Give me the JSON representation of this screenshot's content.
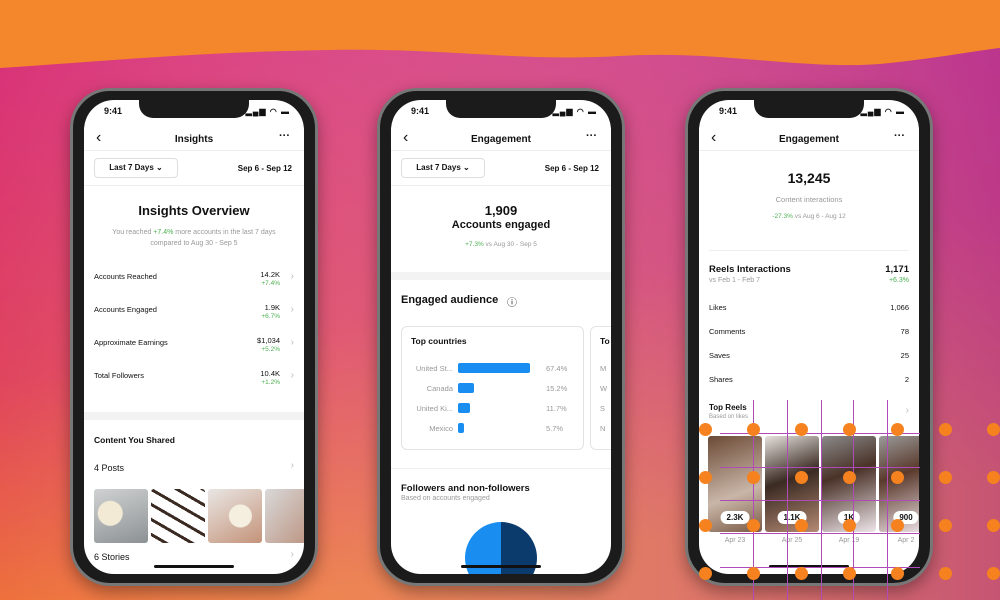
{
  "colors": {
    "accent_blue": "#1a8ef0",
    "pie_dark": "#0b3a6c",
    "positive": "#4caf50",
    "bg_orange": "#f4872c",
    "bg_magenta": "#d8327a"
  },
  "status_time": "9:41",
  "phone1": {
    "title": "Insights",
    "range_select": "Last 7 Days",
    "date_range": "Sep 6 - Sep 12",
    "overview_title": "Insights Overview",
    "overview_text_pre": "You reached ",
    "overview_text_pct": "+7.4%",
    "overview_text_post": " more accounts in the last 7 days compared to Aug 30 - Sep 5",
    "metrics": [
      {
        "label": "Accounts Reached",
        "value": "14.2K",
        "change": "+7.4%"
      },
      {
        "label": "Accounts Engaged",
        "value": "1.9K",
        "change": "+6.7%"
      },
      {
        "label": "Approximate Earnings",
        "value": "$1,034",
        "change": "+5.2%"
      },
      {
        "label": "Total Followers",
        "value": "10.4K",
        "change": "+1.2%"
      }
    ],
    "content_title": "Content You Shared",
    "posts": "4 Posts",
    "stories": "6 Stories"
  },
  "phone2": {
    "title": "Engagement",
    "range_select": "Last 7 Days",
    "date_range": "Sep 6 - Sep 12",
    "big_number": "1,909",
    "big_label": "Accounts engaged",
    "change": "+7.3%",
    "compare": " vs Aug 30 - Sep 5",
    "audience_title": "Engaged audience",
    "top_countries_title": "Top countries",
    "countries": [
      {
        "name": "United St...",
        "pct": 67.4,
        "label": "67.4%"
      },
      {
        "name": "Canada",
        "pct": 15.2,
        "label": "15.2%"
      },
      {
        "name": "United Ki...",
        "pct": 11.7,
        "label": "11.7%"
      },
      {
        "name": "Mexico",
        "pct": 5.7,
        "label": "5.7%"
      }
    ],
    "second_card_title": "To",
    "second_card_letters": [
      "M",
      "W",
      "S",
      "N"
    ],
    "followers_title": "Followers and non-followers",
    "followers_sub": "Based on accounts engaged"
  },
  "phone3": {
    "title": "Engagement",
    "big_number": "13,245",
    "big_label": "Content interactions",
    "change": "-27.3%",
    "compare": " vs Aug 6 - Aug 12",
    "reels_title": "Reels Interactions",
    "reels_compare": "vs Feb 1 - Feb 7",
    "reels_total": "1,171",
    "reels_change": "+6.3%",
    "rows": [
      {
        "label": "Likes",
        "value": "1,066"
      },
      {
        "label": "Comments",
        "value": "78"
      },
      {
        "label": "Saves",
        "value": "25"
      },
      {
        "label": "Shares",
        "value": "2"
      }
    ],
    "top_reels_title": "Top Reels",
    "top_reels_sub": "Based on likes",
    "reels": [
      {
        "count": "2.3K",
        "date": "Apr 23"
      },
      {
        "count": "1.1K",
        "date": "Apr 25"
      },
      {
        "count": "1K",
        "date": "Apr 19"
      },
      {
        "count": "900",
        "date": "Apr 2"
      }
    ]
  }
}
